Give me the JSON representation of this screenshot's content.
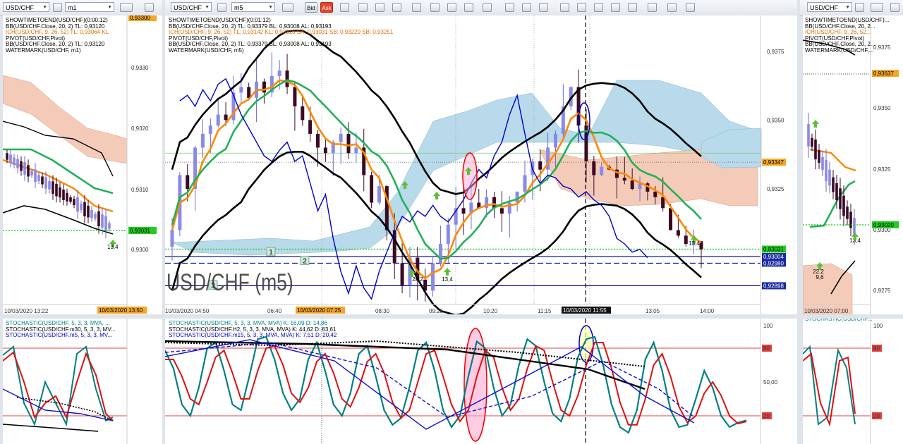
{
  "windows": {
    "left": {
      "symbol": "USD/CHF",
      "timeframe": "m1",
      "legend": [
        {
          "text": "SHOWTIMETOEND(USD/CHF)(0:00:12)",
          "color": "#000000"
        },
        {
          "text": "BB(USD/CHF.Close, 20, 2)  TL: 0,93120",
          "color": "#000000"
        },
        {
          "text": "ICH(USD/CHF, 9, 26, 52)  TL: 0,93064  KL",
          "color": "#e07000"
        },
        {
          "text": "PIVOT(USD/CHF,Pivot)",
          "color": "#000000"
        },
        {
          "text": "BB(USD/CHF.Close, 20, 2)  TL: 0,93120",
          "color": "#000000"
        },
        {
          "text": "WATERMARK(USD/CHF, m1)",
          "color": "#000000"
        }
      ],
      "price_ticks": [
        "0,9330",
        "0,9320",
        "0,9310",
        "0,9300"
      ],
      "tag_top": "0,93300",
      "tag_price": "0,93031",
      "marker_label": "13,4",
      "time_labels": [
        "10/03/2020 13:22"
      ],
      "time_highlight": "10/03/2020 13:50",
      "osc_legend": [
        {
          "text": "STOCHASTIC(USD/CHF, 5, 3, 3, MVA, ...",
          "color": "#008080"
        },
        {
          "text": "STOCHASTIC(USD/CHF.m30, 5, 3, 3, MV...",
          "color": "#000000"
        },
        {
          "text": "STOCHASTIC(USD/CHF.m5, 5, 3, 3, MV...",
          "color": "#0000cc"
        }
      ]
    },
    "center": {
      "symbol": "USD/CHF",
      "timeframe": "m5",
      "toolbar_bid": "Bid",
      "toolbar_ask": "Ask",
      "legend": [
        {
          "text": "SHOWTIMETOEND(USD/CHF)(0:01:12)",
          "color": "#000000"
        },
        {
          "text": "BB(USD/CHF.Close, 20, 2)  TL: 0,93379  BL: 0,93008  AL: 0,93193",
          "color": "#000000"
        },
        {
          "text": "ICH(USD/CHF, 9, 26, 52)  TL: 0,93142  KL: 0,93316  SA: 0,93031  SB: 0,93229  SB: 0,93251",
          "color": "#e07000"
        },
        {
          "text": "PIVOT(USD/CHF,Pivot)",
          "color": "#000000"
        },
        {
          "text": "BB(USD/CHF.Close, 20, 2)  TL: 0,93379  BL: 0,93008  AL: 0,93193",
          "color": "#000000"
        },
        {
          "text": "WATERMARK(USD/CHF, m5)",
          "color": "#000000"
        }
      ],
      "watermark": "USD/CHF (m5)",
      "price_ticks": [
        "0,9375",
        "0,9350",
        "0,9325",
        "0,9300"
      ],
      "tag_ich": "0,93347",
      "tag_price": "0,93031",
      "tag_pivot1": "0,93004",
      "tag_pivot2": "0,92980",
      "tag_pivot3": "0,92898",
      "pivot_labels": [
        "1",
        "2",
        "3"
      ],
      "marker_labels": [
        "22,2",
        "13,4",
        "13,4"
      ],
      "time_labels": [
        "10/03/2020 04:50",
        "06:40",
        "08:30",
        "09:25",
        "10:20",
        "11:15",
        "13:05",
        "14:00"
      ],
      "time_highlight": "10/03/2020 07:25",
      "time_cursor": "10/03/2020 11:55",
      "osc_legend": [
        {
          "text": "STOCHASTIC(USD/CHF, 5, 3, 3, MVA, MVA)  K: 16,09  D: 14,86",
          "color": "#008080"
        },
        {
          "text": "STOCHASTIC(USD/CHF.H2, 5, 3, 3, MVA, MVA)  K: 44,62  D: 63,61",
          "color": "#000000"
        },
        {
          "text": "STOCHASTIC(USD/CHF.m15, 5, 3, 3, MVA, MVA)  K: 7,51  D: 20,42",
          "color": "#0000cc"
        }
      ],
      "osc_ticks": [
        "100",
        "80",
        "50,00",
        "20",
        "0"
      ]
    },
    "right": {
      "symbol": "USD/CHF",
      "legend": [
        {
          "text": "SHOWTIMETOEND(USD/CHF)...",
          "color": "#000000"
        },
        {
          "text": "BB(USD/CHF.Close, 20, 2...",
          "color": "#000000"
        },
        {
          "text": "ICH(USD/CHF, 9, 26, 52...",
          "color": "#e07000"
        },
        {
          "text": "PIVOT(USD/CHF,Pivot)",
          "color": "#000000"
        },
        {
          "text": "BB(USD/CHF.Close, 20, 2...",
          "color": "#000000"
        },
        {
          "text": "WATERMARK(USD/CHF,...",
          "color": "#000000"
        }
      ],
      "price_ticks": [
        "0,9375",
        "0,9350",
        "0,9325",
        "0,9300",
        "0,9275"
      ],
      "tag_top": "0,93637",
      "tag_price": "0,93020",
      "marker_labels": [
        "22,2",
        "9,6",
        "13,4"
      ],
      "time_labels": [
        "10/03/2020 07:00"
      ],
      "osc_legend": [
        {
          "text": "STOCHASTIC(USD/CHF...",
          "color": "#008080"
        }
      ],
      "osc_ticks": [
        "100",
        "80",
        "20"
      ]
    }
  },
  "colors": {
    "cloud_bull": "#b8daea",
    "cloud_bear": "#f4cbb8",
    "bollinger": "#000000",
    "tenkan": "#ff8800",
    "kijun": "#22b05a",
    "chikou": "#0000cc",
    "stoch_k": "#008080",
    "stoch_d": "#e01010",
    "price_line": "#00cc00",
    "pivot": "#000080",
    "level_line": "#e04040",
    "candle_up": "#8a8ae8",
    "candle_down": "#3a0a24",
    "highlight": "#ffaad0"
  },
  "chart_data": {
    "type": "candlestick",
    "symbol": "USD/CHF",
    "timeframe": "m5",
    "date": "10/03/2020",
    "ylim": [
      0.9283,
      0.9388
    ],
    "y_ticks": [
      0.9375,
      0.935,
      0.9325,
      0.93
    ],
    "x_ticks": [
      "04:50",
      "06:40",
      "08:30",
      "09:25",
      "10:20",
      "11:15",
      "13:05",
      "14:00"
    ],
    "close": [
      0.931,
      0.933,
      0.9325,
      0.934,
      0.9345,
      0.9348,
      0.9352,
      0.935,
      0.936,
      0.9362,
      0.9358,
      0.9364,
      0.936,
      0.9366,
      0.9368,
      0.9362,
      0.9355,
      0.935,
      0.9345,
      0.934,
      0.9338,
      0.9342,
      0.9345,
      0.9338,
      0.934,
      0.933,
      0.932,
      0.9326,
      0.931,
      0.9298,
      0.929,
      0.93,
      0.9292,
      0.9288,
      0.9298,
      0.9305,
      0.9312,
      0.9318,
      0.9316,
      0.932,
      0.9318,
      0.9322,
      0.9318,
      0.9316,
      0.932,
      0.9324,
      0.933,
      0.9335,
      0.9332,
      0.934,
      0.9345,
      0.9355,
      0.9362,
      0.9348,
      0.9335,
      0.933,
      0.9333,
      0.9332,
      0.9329,
      0.9328,
      0.9325,
      0.9327,
      0.9324,
      0.9322,
      0.9318,
      0.931,
      0.9308,
      0.9305,
      0.9306,
      0.9303
    ],
    "pivots": [
      0.93004,
      0.9298,
      0.92898
    ],
    "last_price": 0.93031,
    "oscillator": {
      "title": "STOCHASTIC(USD/CHF, 5, 3, 3, MVA, MVA)",
      "ylim": [
        0,
        100
      ],
      "levels": [
        20,
        80
      ],
      "K": [
        78,
        62,
        30,
        20,
        45,
        80,
        85,
        60,
        30,
        25,
        55,
        88,
        90,
        70,
        40,
        25,
        35,
        70,
        85,
        60,
        30,
        20,
        40,
        75,
        82,
        55,
        25,
        12,
        18,
        45,
        78,
        85,
        60,
        25,
        10,
        20,
        55,
        86,
        80,
        45,
        20,
        30,
        65,
        88,
        82,
        50,
        22,
        15,
        35,
        72,
        88,
        90,
        65,
        30,
        10,
        5,
        25,
        70,
        85,
        60,
        25,
        10,
        12,
        35,
        60,
        45,
        20,
        10,
        14,
        16
      ],
      "D": [
        70,
        70,
        55,
        35,
        30,
        50,
        72,
        78,
        58,
        35,
        35,
        60,
        80,
        82,
        65,
        40,
        32,
        45,
        68,
        75,
        58,
        35,
        28,
        45,
        68,
        75,
        58,
        32,
        18,
        25,
        50,
        75,
        78,
        55,
        30,
        15,
        25,
        55,
        78,
        72,
        45,
        25,
        35,
        62,
        82,
        78,
        50,
        25,
        20,
        38,
        65,
        85,
        85,
        62,
        32,
        12,
        12,
        35,
        65,
        75,
        55,
        28,
        14,
        20,
        40,
        50,
        38,
        20,
        13,
        15
      ],
      "H2_K": 44.62,
      "H2_D": 63.61,
      "m15_K": 7.51,
      "m15_D": 20.42
    }
  }
}
